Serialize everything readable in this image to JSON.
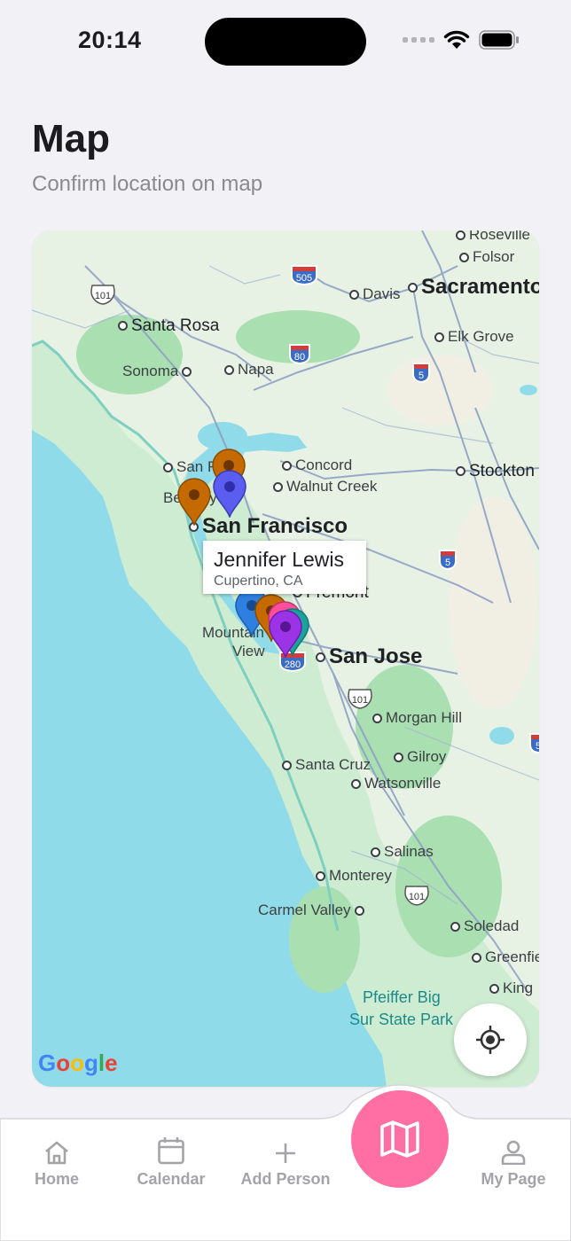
{
  "status_bar": {
    "time": "20:14"
  },
  "header": {
    "title": "Map",
    "subtitle": "Confirm location on map"
  },
  "map": {
    "labels": {
      "roseville": "Roseville",
      "folsom": "Folsor",
      "sacramento": "Sacramento",
      "davis": "Davis",
      "santa_rosa": "Santa Rosa",
      "elk_grove": "Elk Grove",
      "sonoma": "Sonoma",
      "napa": "Napa",
      "san_rafael": "San R",
      "concord": "Concord",
      "stockton": "Stockton",
      "berkeley": "Be",
      "berkeley_tail": "ey",
      "walnut_creek": "Walnut Creek",
      "san_francisco": "San Francisco",
      "fremont": "Fremont",
      "mountain_view_1": "Mountain",
      "mountain_view_2": "View",
      "san_jose": "San Jose",
      "morgan_hill": "Morgan Hill",
      "santa_cruz": "Santa Cruz",
      "gilroy": "Gilroy",
      "watsonville": "Watsonville",
      "salinas": "Salinas",
      "monterey": "Monterey",
      "carmel_valley": "Carmel Valley",
      "soledad": "Soledad",
      "greenfield": "Greenfiel",
      "king": "King",
      "pfeiffer_1": "Pfeiffer Big",
      "pfeiffer_2": "Sur State Park"
    },
    "shields": {
      "i505": "505",
      "i80": "80",
      "i5a": "5",
      "i5b": "5",
      "i5c": "5",
      "us101a": "101",
      "us101b": "101",
      "us101c": "101",
      "i280": "280"
    },
    "selected_marker": {
      "name": "Jennifer Lewis",
      "location": "Cupertino, CA"
    },
    "attribution": "Google",
    "colors": {
      "orange": "#c46a00",
      "blue": "#5b5cf0",
      "purple": "#9b33e6",
      "pink": "#ff4f9a",
      "teal": "#1aa39a",
      "azure": "#2f7fe0"
    }
  },
  "tabbar": {
    "home": "Home",
    "calendar": "Calendar",
    "add_person": "Add Person",
    "map_icon": "map-icon",
    "my_page": "My Page"
  }
}
